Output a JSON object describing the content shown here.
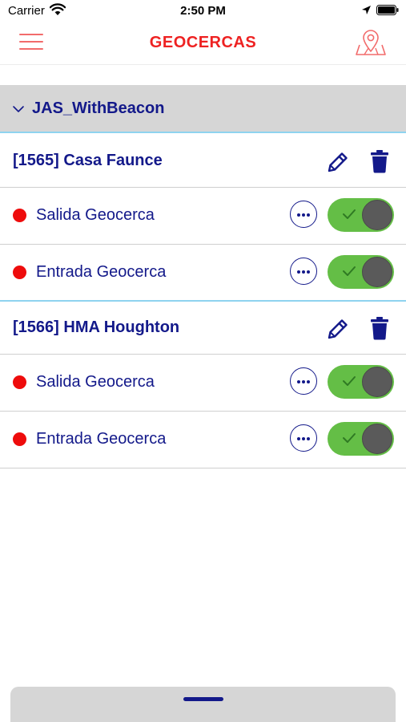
{
  "status_bar": {
    "carrier": "Carrier",
    "time": "2:50 PM",
    "icons": [
      "wifi-icon",
      "location-arrow-icon",
      "battery-icon"
    ]
  },
  "nav": {
    "title": "GEOCERCAS",
    "left_icon": "hamburger-menu-icon",
    "right_icon": "map-pin-icon"
  },
  "group": {
    "title": "JAS_WithBeacon",
    "expanded": true
  },
  "fences": [
    {
      "title": "[1565] Casa Faunce",
      "events": [
        {
          "label": "Salida Geocerca",
          "enabled": true
        },
        {
          "label": "Entrada Geocerca",
          "enabled": true
        }
      ]
    },
    {
      "title": "[1566] HMA Houghton",
      "events": [
        {
          "label": "Salida Geocerca",
          "enabled": true
        },
        {
          "label": "Entrada Geocerca",
          "enabled": true
        }
      ]
    }
  ],
  "colors": {
    "brand_red": "#ee2222",
    "text_navy": "#13198a",
    "toggle_on": "#64be46",
    "status_dot": "#ee0c0c",
    "group_bg": "#d6d6d6",
    "accent_line": "#8fd3ef"
  }
}
